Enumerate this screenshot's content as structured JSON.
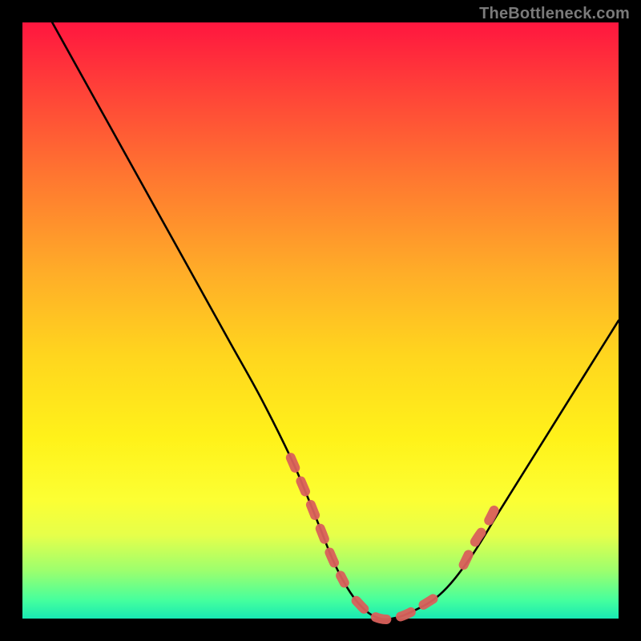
{
  "watermark": "TheBottleneck.com",
  "chart_data": {
    "type": "line",
    "title": "",
    "xlabel": "",
    "ylabel": "",
    "xlim": [
      0,
      100
    ],
    "ylim": [
      0,
      100
    ],
    "grid": false,
    "series": [
      {
        "name": "bottleneck-curve",
        "color": "#000000",
        "x": [
          5,
          10,
          15,
          20,
          25,
          30,
          35,
          40,
          45,
          48,
          50,
          52,
          54,
          56,
          58,
          60,
          62,
          65,
          70,
          75,
          80,
          85,
          90,
          95,
          100
        ],
        "y": [
          100,
          91,
          82,
          73,
          64,
          55,
          46,
          37,
          27,
          20,
          15,
          10,
          6,
          3,
          1,
          0,
          0,
          1,
          4,
          10,
          18,
          26,
          34,
          42,
          50
        ]
      },
      {
        "name": "highlight-segments",
        "color": "#d9605b",
        "segments": [
          {
            "x": [
              45,
              48,
              50,
              52,
              54
            ],
            "y": [
              27,
              20,
              15,
              10,
              6
            ]
          },
          {
            "x": [
              56,
              58,
              60,
              62,
              65,
              70
            ],
            "y": [
              3,
              1,
              0,
              0,
              1,
              4
            ]
          },
          {
            "x": [
              74,
              76,
              78,
              80
            ],
            "y": [
              9,
              13,
              16,
              20
            ]
          }
        ]
      }
    ]
  }
}
